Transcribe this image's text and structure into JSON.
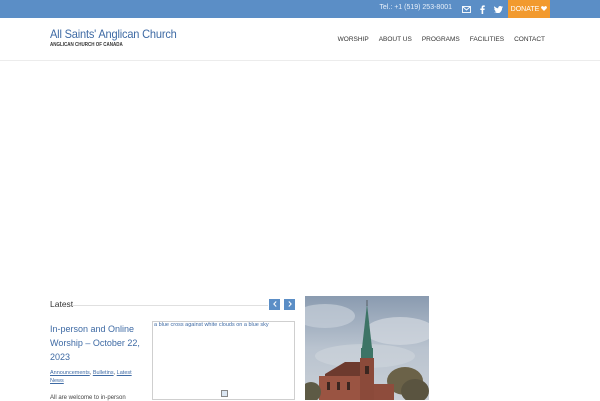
{
  "topbar": {
    "phone": "Tel.: +1 (519) 253-8001",
    "icons": [
      "mail-icon",
      "facebook-icon",
      "twitter-icon"
    ],
    "donate_label": "DONATE"
  },
  "header": {
    "title": "All Saints' Anglican Church",
    "subtitle": "ANGLICAN CHURCH OF CANADA"
  },
  "nav": {
    "items": [
      "WORSHIP",
      "ABOUT US",
      "PROGRAMS",
      "FACILITIES",
      "CONTACT"
    ]
  },
  "latest": {
    "heading": "Latest",
    "post": {
      "title": "In-person and Online Worship – October 22, 2023",
      "categories": [
        "Announcements",
        "Bulletins",
        "Latest News"
      ],
      "excerpt": "All are welcome to in-person",
      "image_alt": "a blue cross against white clouds on a blue sky"
    }
  },
  "colors": {
    "accent": "#5b8ec6",
    "title_blue": "#3e6aa4",
    "donate": "#f29a2e"
  }
}
